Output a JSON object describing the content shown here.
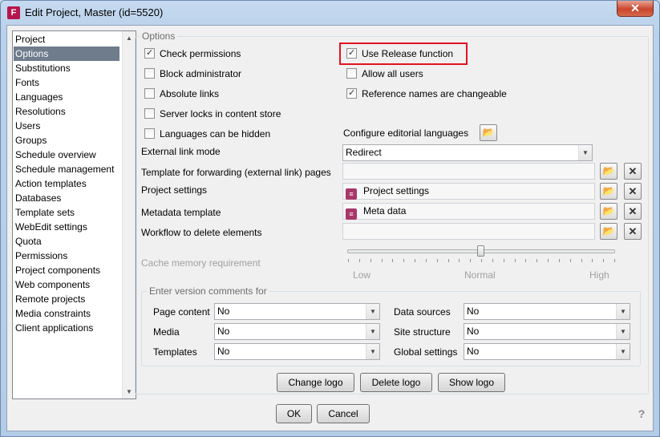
{
  "window": {
    "title": "Edit Project, Master (id=5520)",
    "close_label": "✕"
  },
  "nav": {
    "items": [
      "Project",
      "Options",
      "Substitutions",
      "Fonts",
      "Languages",
      "Resolutions",
      "Users",
      "Groups",
      "Schedule overview",
      "Schedule management",
      "Action templates",
      "Databases",
      "Template sets",
      "WebEdit settings",
      "Quota",
      "Permissions",
      "Project components",
      "Web components",
      "Remote projects",
      "Media constraints",
      "Client applications"
    ],
    "selected": "Options",
    "scroll_up": "▲",
    "scroll_down": "▼"
  },
  "options": {
    "legend": "Options",
    "check_permissions": {
      "label": "Check permissions",
      "checked": true
    },
    "use_release": {
      "label": "Use Release function",
      "checked": true
    },
    "block_admin": {
      "label": "Block administrator",
      "checked": false
    },
    "allow_all_users": {
      "label": "Allow all users",
      "checked": false
    },
    "absolute_links": {
      "label": "Absolute links",
      "checked": false
    },
    "reference_names": {
      "label": "Reference names are changeable",
      "checked": true
    },
    "server_locks": {
      "label": "Server locks in content store",
      "checked": false
    },
    "languages_hidden": {
      "label": "Languages can be hidden",
      "checked": false
    },
    "configure_languages_label": "Configure editorial languages",
    "external_link_mode": {
      "label": "External link mode",
      "value": "Redirect"
    },
    "template_forwarding": {
      "label": "Template for forwarding (external link) pages",
      "value": ""
    },
    "project_settings": {
      "label": "Project settings",
      "value": "Project settings"
    },
    "metadata_template": {
      "label": "Metadata template",
      "value": "Meta data"
    },
    "workflow_delete": {
      "label": "Workflow to delete elements",
      "value": ""
    },
    "cache_memory": {
      "label": "Cache memory requirement",
      "low": "Low",
      "normal": "Normal",
      "high": "High",
      "level": 0.5
    }
  },
  "version_comments": {
    "legend": "Enter version comments for",
    "page_content": {
      "label": "Page content",
      "value": "No"
    },
    "media": {
      "label": "Media",
      "value": "No"
    },
    "templates": {
      "label": "Templates",
      "value": "No"
    },
    "data_sources": {
      "label": "Data sources",
      "value": "No"
    },
    "site_structure": {
      "label": "Site structure",
      "value": "No"
    },
    "global_settings": {
      "label": "Global settings",
      "value": "No"
    }
  },
  "logo_buttons": {
    "change": "Change logo",
    "delete": "Delete logo",
    "show": "Show logo"
  },
  "footer": {
    "ok": "OK",
    "cancel": "Cancel",
    "help": "?"
  },
  "icons": {
    "checkmark": "✓",
    "dropdown": "▼",
    "folder": "📂",
    "remove": "✕",
    "doc": "≡"
  },
  "colors": {
    "selection": "#6f7c8c",
    "highlight": "#e0141f",
    "app_icon": "#b5164e"
  }
}
